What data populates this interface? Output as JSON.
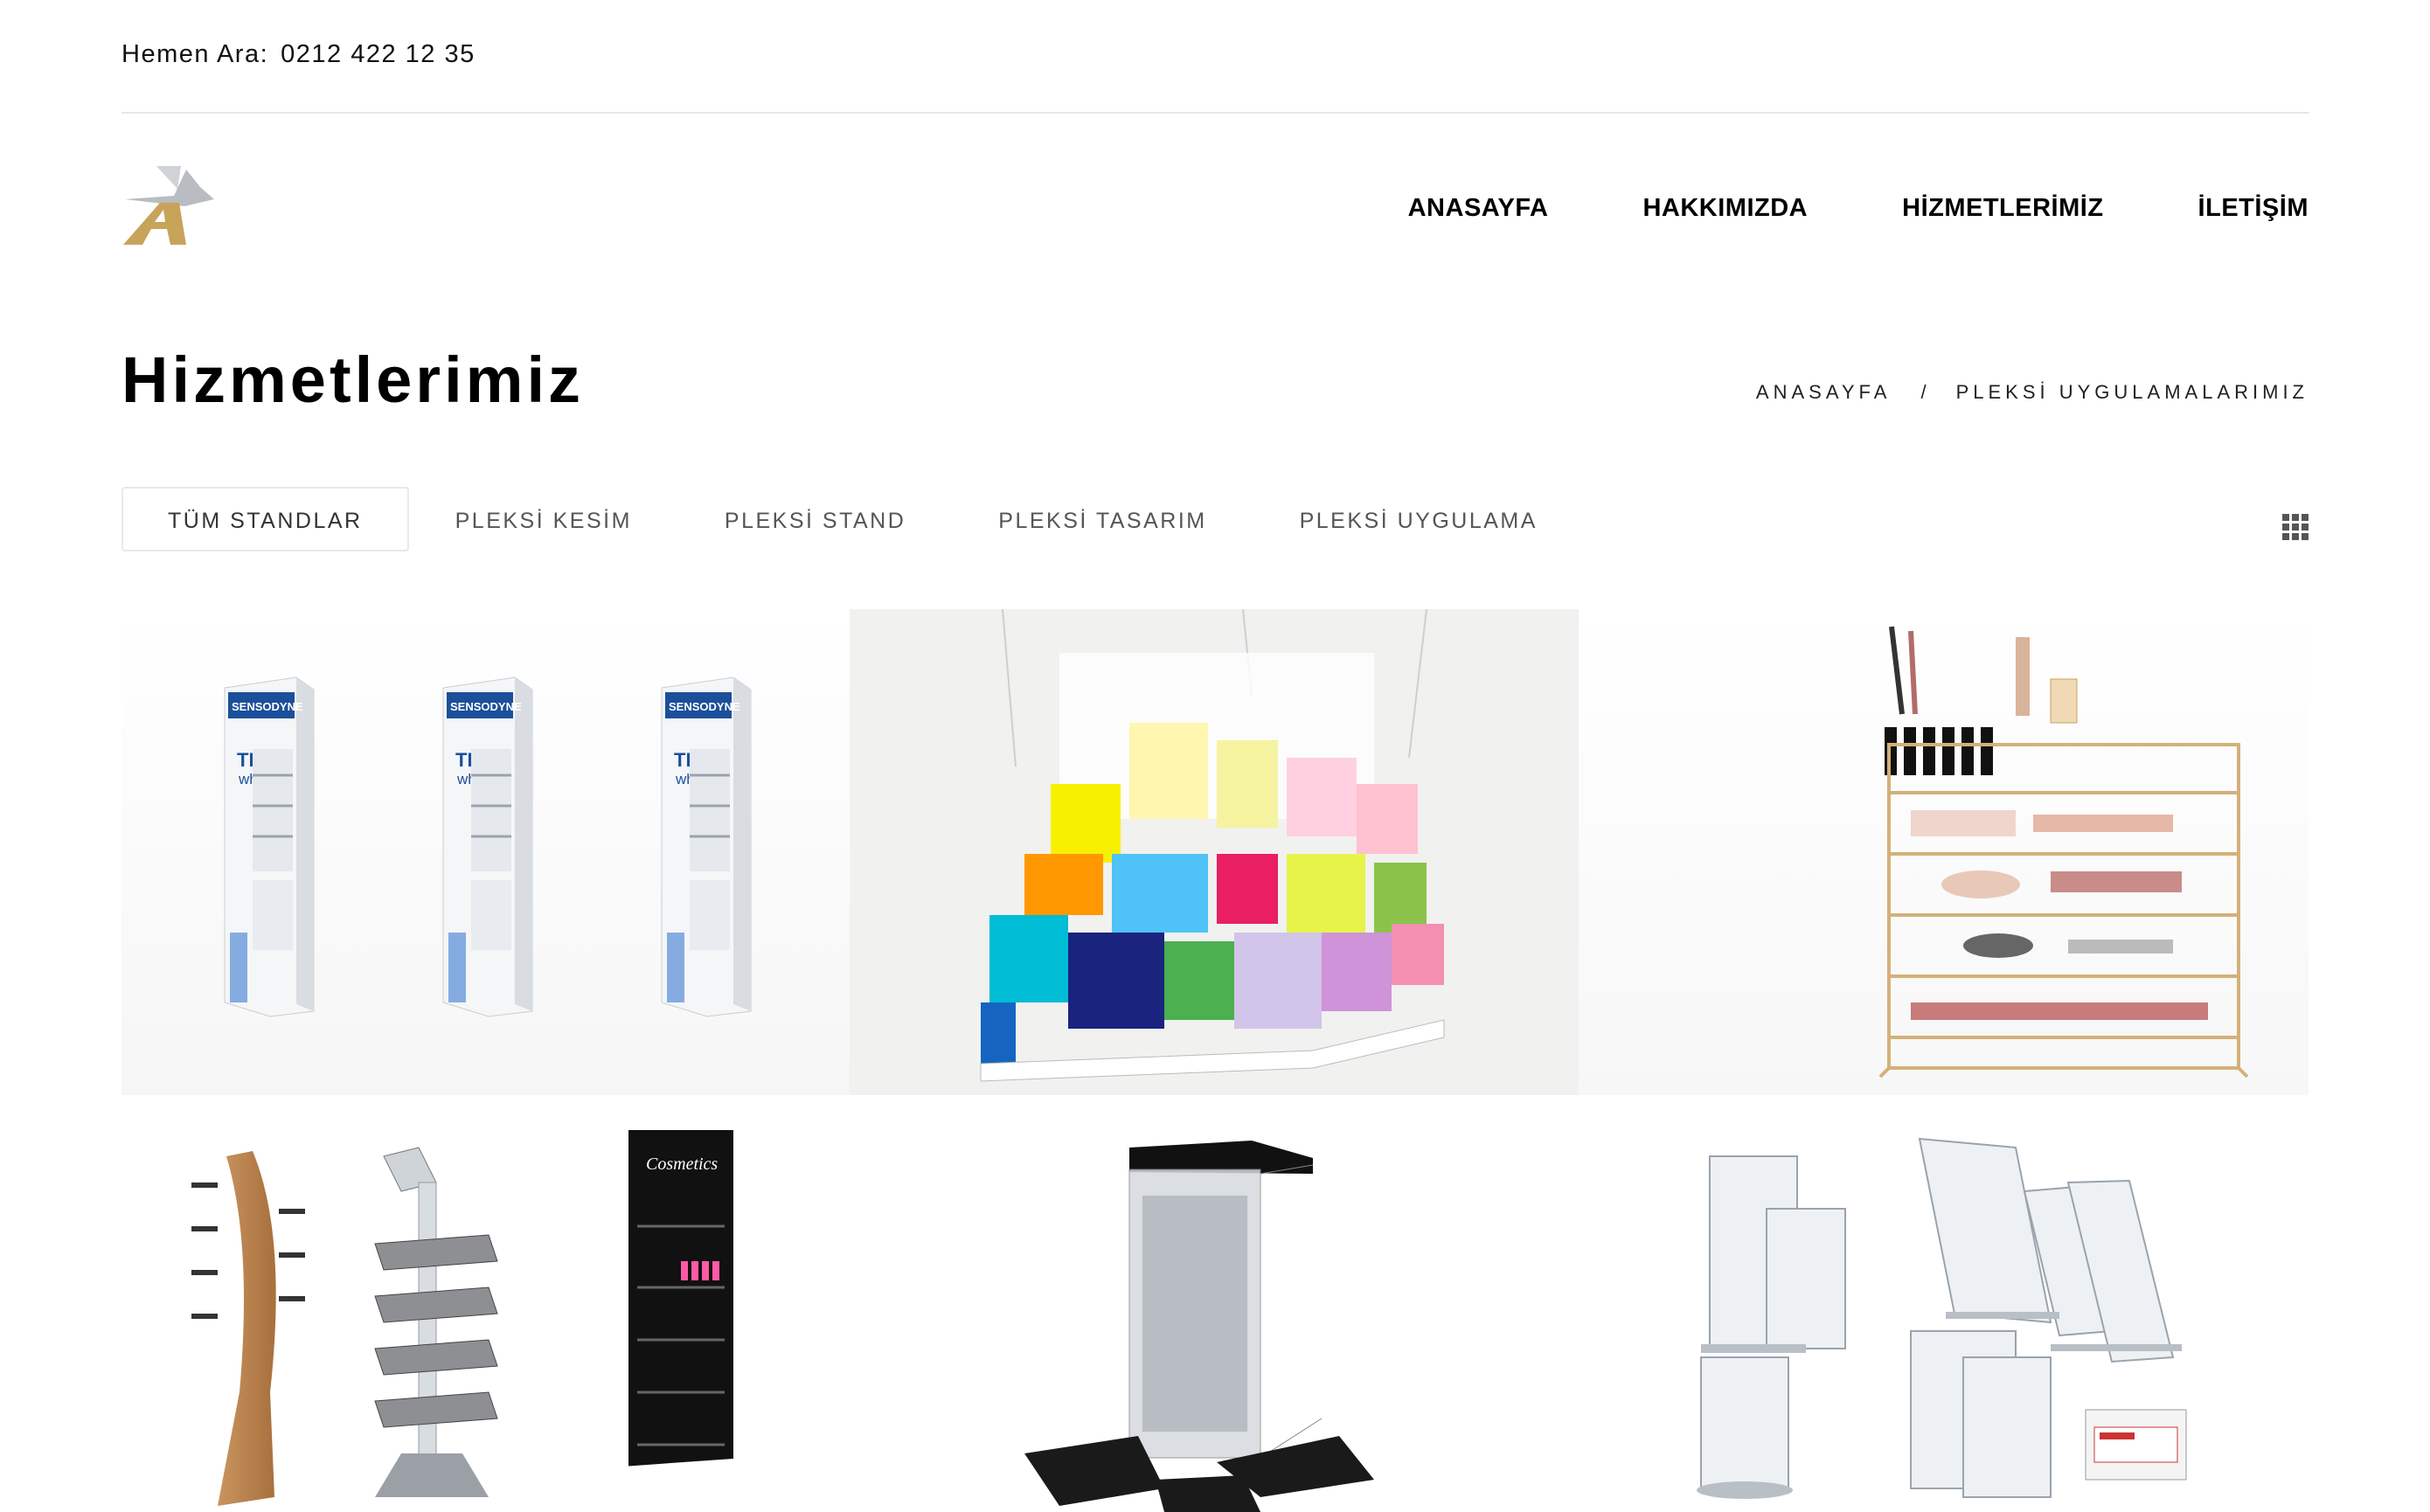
{
  "topbar": {
    "call_label": "Hemen Ara:",
    "phone": "0212 422 12 35"
  },
  "brand": {
    "logo_icon": "eagle-logo-icon",
    "gold": "#c8a35a",
    "silver": "#b9bdc2"
  },
  "nav": {
    "items": [
      {
        "label": "ANASAYFA"
      },
      {
        "label": "HAKKIMIZDA"
      },
      {
        "label": "HİZMETLERİMİZ"
      },
      {
        "label": "İLETİŞİM"
      }
    ]
  },
  "page": {
    "title": "Hizmetlerimiz"
  },
  "breadcrumb": {
    "home": "ANASAYFA",
    "separator": "/",
    "current": "PLEKSİ UYGULAMALARIMIZ"
  },
  "filters": {
    "items": [
      {
        "label": "TÜM STANDLAR",
        "active": true
      },
      {
        "label": "PLEKSİ KESİM",
        "active": false
      },
      {
        "label": "PLEKSİ STAND",
        "active": false
      },
      {
        "label": "PLEKSİ TASARIM",
        "active": false
      },
      {
        "label": "PLEKSİ UYGULAMA",
        "active": false
      }
    ],
    "view_toggle_icon": "grid-view-icon"
  },
  "gallery": {
    "products": [
      {
        "image": "sensodyne-display-stands",
        "brand": "SENSODYNE",
        "product": "TRUE white"
      },
      {
        "image": "colorful-plexi-cube-installation"
      },
      {
        "image": "acrylic-makeup-organizer"
      },
      {
        "image": "cosmetics-floor-stands",
        "brand": "Cosmetics"
      },
      {
        "image": "acrylic-brochure-holder"
      },
      {
        "image": "acrylic-sign-holders"
      }
    ]
  }
}
